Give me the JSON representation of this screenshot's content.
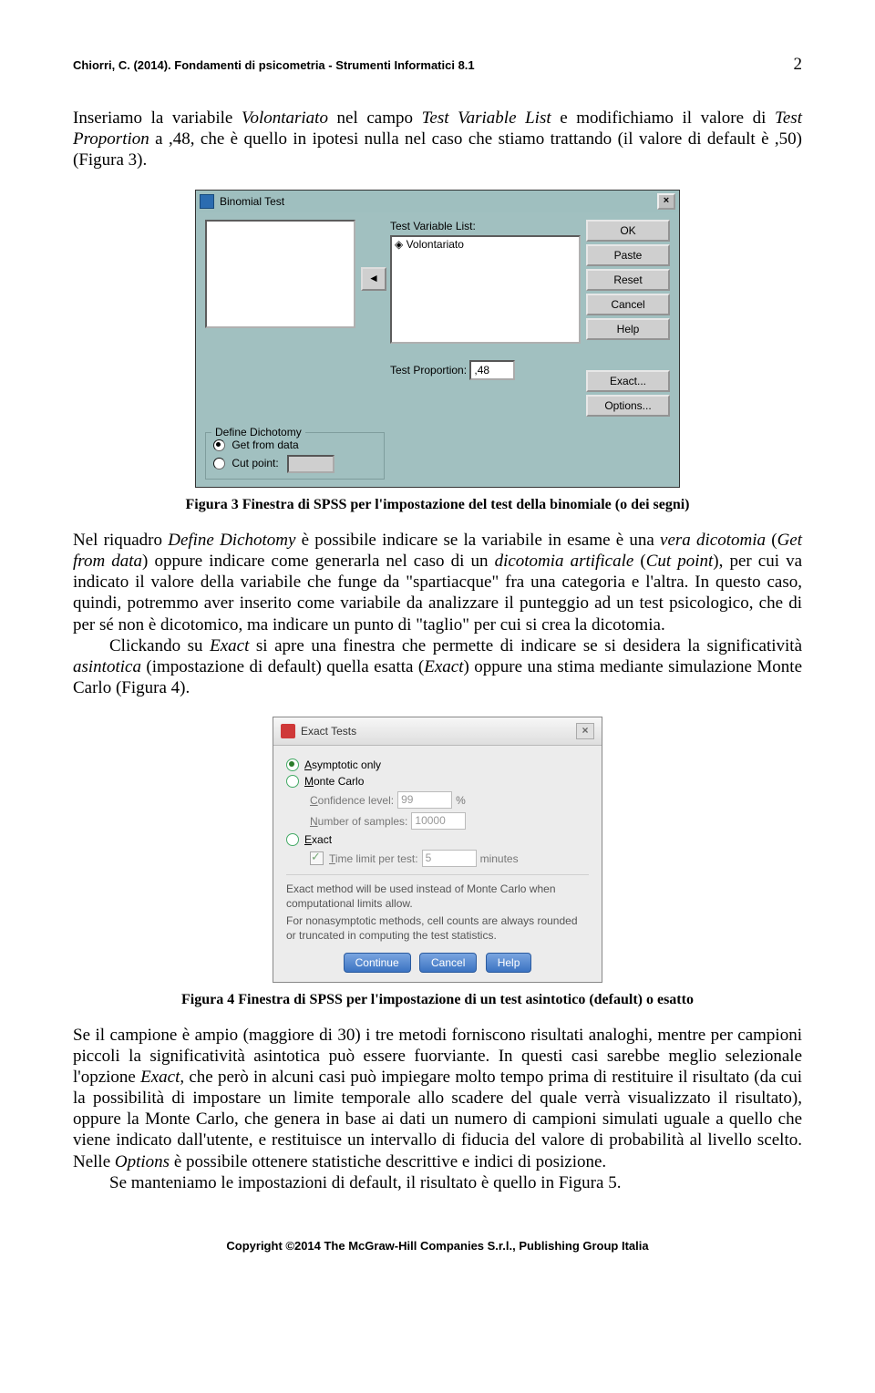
{
  "header": {
    "left": "Chiorri, C. (2014). Fondamenti di psicometria - Strumenti Informatici 8.1",
    "right": "2"
  },
  "para1_parts": [
    "Inseriamo la variabile ",
    {
      "i": "Volontariato"
    },
    " nel campo ",
    {
      "i": "Test Variable List "
    },
    "e modifichiamo il valore di ",
    {
      "i": "Test Proportion "
    },
    "a ,48, che è quello in ipotesi nulla nel caso che stiamo trattando (il valore di default è ,50) (Figura 3)."
  ],
  "binomial": {
    "title": "Binomial Test",
    "tvl_label": "Test Variable List:",
    "var_item": "Volontariato",
    "test_prop_label": "Test Proportion:",
    "test_prop_value": ",48",
    "dichotomy_legend": "Define Dichotomy",
    "opt_get": "Get from data",
    "opt_cut": "Cut point:",
    "btn_ok": "OK",
    "btn_paste": "Paste",
    "btn_reset": "Reset",
    "btn_cancel": "Cancel",
    "btn_help": "Help",
    "btn_exact": "Exact...",
    "btn_options": "Options..."
  },
  "caption3": "Figura 3 Finestra di SPSS per l'impostazione del test della binomiale (o dei segni)",
  "para2_parts": [
    "Nel riquadro ",
    {
      "i": "Define Dichotomy"
    },
    " è possibile indicare se la variabile in esame è una ",
    {
      "i": "vera dicotomia"
    },
    " (",
    {
      "i": "Get from data"
    },
    ") oppure indicare come generarla nel caso di un ",
    {
      "i": "dicotomia artificale"
    },
    " (",
    {
      "i": "Cut point"
    },
    "), per cui va indicato il valore della variabile che funge da \"spartiacque\" fra una categoria e l'altra. In questo caso, quindi, potremmo aver inserito come variabile da analizzare il punteggio ad un test psicologico, che di per sé non è dicotomico, ma indicare un punto di \"taglio\" per cui si crea la dicotomia."
  ],
  "para3_parts": [
    "Clickando su ",
    {
      "i": "Exact"
    },
    " si apre una finestra che permette di indicare se si desidera la significatività ",
    {
      "i": "asintotica"
    },
    " (impostazione di default) quella esatta (",
    {
      "i": "Exact"
    },
    ") oppure una stima mediante simulazione Monte Carlo (Figura 4)."
  ],
  "exact": {
    "title": "Exact Tests",
    "opt_asym": "Asymptotic only",
    "opt_mc": "Monte Carlo",
    "conf_label": "Confidence level:",
    "conf_val": "99",
    "pct": "%",
    "nsamp_label": "Number of samples:",
    "nsamp_val": "10000",
    "opt_exact": "Exact",
    "time_label": "Time limit per test:",
    "time_val": "5",
    "time_unit": "minutes",
    "note1": "Exact method will be used instead of Monte Carlo when computational limits allow.",
    "note2": "For nonasymptotic methods, cell counts are always rounded or truncated in computing the test statistics.",
    "btn_continue": "Continue",
    "btn_cancel": "Cancel",
    "btn_help": "Help"
  },
  "caption4": "Figura 4 Finestra di SPSS per l'impostazione di un test asintotico (default) o esatto",
  "para4_parts": [
    "Se il campione è ampio (maggiore di 30) i tre metodi forniscono risultati analoghi, mentre per campioni piccoli la significatività asintotica può essere fuorviante. In questi casi sarebbe meglio selezionale l'opzione ",
    {
      "i": "Exact"
    },
    ", che però in alcuni casi può impiegare molto tempo prima di restituire il risultato (da cui la possibilità di impostare un limite temporale allo scadere del quale verrà visualizzato il risultato), oppure la Monte Carlo, che genera in base ai dati un numero di campioni simulati uguale a quello che viene indicato dall'utente, e restituisce un intervallo di fiducia del valore di probabilità al livello scelto. Nelle ",
    {
      "i": "Options"
    },
    " è possibile ottenere statistiche descrittive e indici di posizione."
  ],
  "para5": "Se manteniamo le impostazioni di default, il risultato è quello in Figura 5.",
  "footer": "Copyright ©2014 The McGraw-Hill Companies S.r.l., Publishing Group Italia"
}
